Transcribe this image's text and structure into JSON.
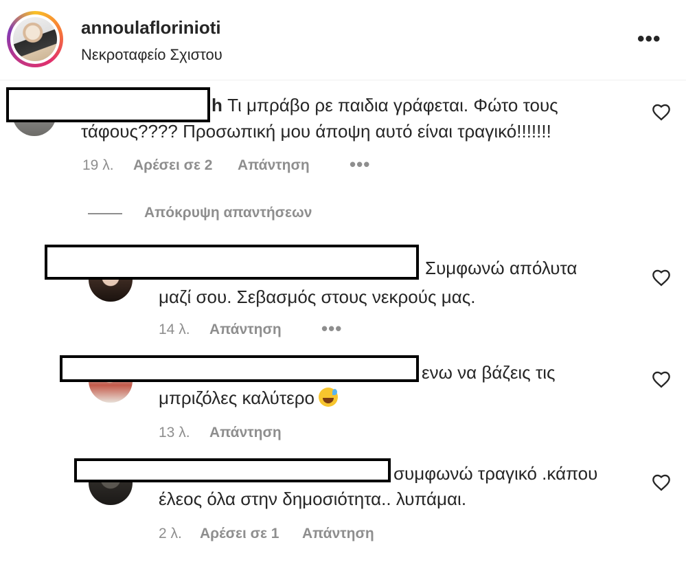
{
  "post": {
    "username": "annoulaflorinioti",
    "location": "Νεκροταφείο Σχιστου",
    "more_label": "•••"
  },
  "comments": [
    {
      "name_suffix": "h",
      "text_line1": " Τι μπράβο ρε παιδια γράφεται. Φώτο τους",
      "text_line2": "τάφους???? Προσωπική μου άποψη αυτό είναι τραγικό!!!!!!!",
      "time": "19 λ.",
      "likes": "Αρέσει σε 2",
      "reply": "Απάντηση",
      "more": "•••"
    }
  ],
  "hide_replies_label": "Απόκρυψη απαντήσεων",
  "replies": [
    {
      "text_line1": "Συμφωνώ απόλυτα",
      "text_line2": "μαζί σου. Σεβασμός στους νεκρούς μας.",
      "time": "14 λ.",
      "reply": "Απάντηση",
      "more": "•••"
    },
    {
      "text_line1": "ενω να βάζεις τις",
      "text_line2": "μπριζόλες καλύτερο",
      "emoji": "sweat-smile-emoji",
      "time": "13 λ.",
      "reply": "Απάντηση"
    },
    {
      "text_line1": "συμφωνώ τραγικό .κάπου",
      "text_line2": "έλεος όλα στην δημοσιότητα.. λυπάμαι.",
      "time": "2 λ.",
      "likes": "Αρέσει σε 1",
      "reply": "Απάντηση"
    }
  ],
  "icons": {
    "like": "heart-outline-icon",
    "more": "more-horizontal-icon"
  }
}
